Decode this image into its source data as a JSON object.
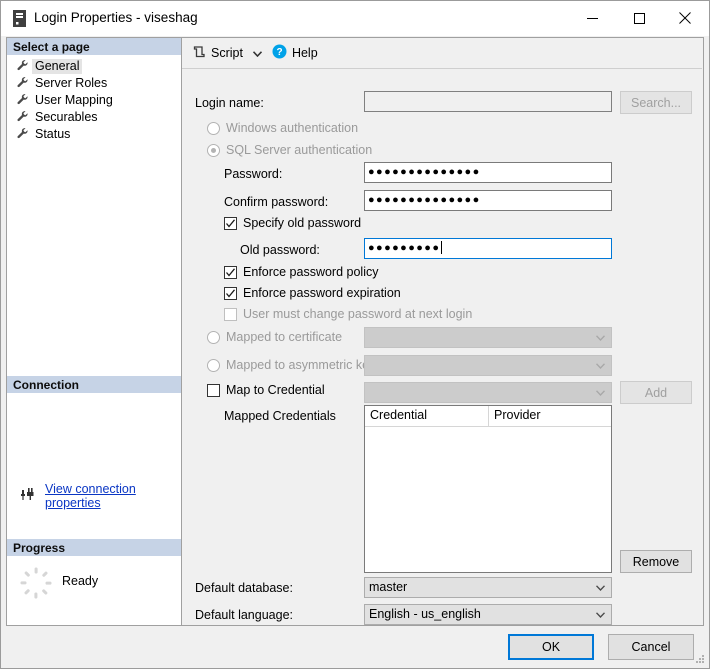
{
  "window": {
    "title": "Login Properties - viseshag",
    "icon": "server-icon",
    "minimize_label": "–",
    "maximize_label": "□",
    "close_label": "✕"
  },
  "sidebar": {
    "pages_header": "Select a page",
    "pages": [
      {
        "label": "General",
        "icon": "wrench-icon",
        "selected": true
      },
      {
        "label": "Server Roles",
        "icon": "wrench-icon",
        "selected": false
      },
      {
        "label": "User Mapping",
        "icon": "wrench-icon",
        "selected": false
      },
      {
        "label": "Securables",
        "icon": "wrench-icon",
        "selected": false
      },
      {
        "label": "Status",
        "icon": "wrench-icon",
        "selected": false
      }
    ],
    "connection_header": "Connection",
    "connection_link": "View connection properties",
    "connection_icon": "connection-plug-icon",
    "progress_header": "Progress",
    "progress_status": "Ready",
    "progress_icon": "spinner-icon"
  },
  "toolbar": {
    "script_label": "Script",
    "script_icon": "script-icon",
    "caret_icon": "chevron-down-icon",
    "help_label": "Help",
    "help_icon": "help-circle-icon"
  },
  "form": {
    "login_name_label": "Login name:",
    "login_name_value": "",
    "search_button": "Search...",
    "windows_auth_label": "Windows authentication",
    "sql_auth_label": "SQL Server authentication",
    "password_label": "Password:",
    "password_value": "●●●●●●●●●●●●●●",
    "confirm_password_label": "Confirm password:",
    "confirm_password_value": "●●●●●●●●●●●●●●",
    "specify_old_password_label": "Specify old password",
    "old_password_label": "Old password:",
    "old_password_value": "●●●●●●●●●",
    "enforce_policy_label": "Enforce password policy",
    "enforce_expiration_label": "Enforce password expiration",
    "must_change_label": "User must change password at next login",
    "mapped_certificate_label": "Mapped to certificate",
    "mapped_certificate_value": "",
    "mapped_asymmetric_label": "Mapped to asymmetric key",
    "mapped_asymmetric_value": "",
    "map_credential_label": "Map to Credential",
    "map_credential_value": "",
    "add_button": "Add",
    "mapped_credentials_label": "Mapped Credentials",
    "credentials_columns": [
      "Credential",
      "Provider"
    ],
    "credentials_rows": [],
    "remove_button": "Remove",
    "default_database_label": "Default database:",
    "default_database_value": "master",
    "default_language_label": "Default language:",
    "default_language_value": "English - us_english"
  },
  "footer": {
    "ok_label": "OK",
    "cancel_label": "Cancel",
    "grip_icon": "resize-grip-icon"
  },
  "colors": {
    "section_header": "#c6d3e6",
    "focus_border": "#0078d7",
    "link": "#0a36c4",
    "dialog_bg": "#f0f0f0",
    "help_icon": "#00a2e8"
  }
}
